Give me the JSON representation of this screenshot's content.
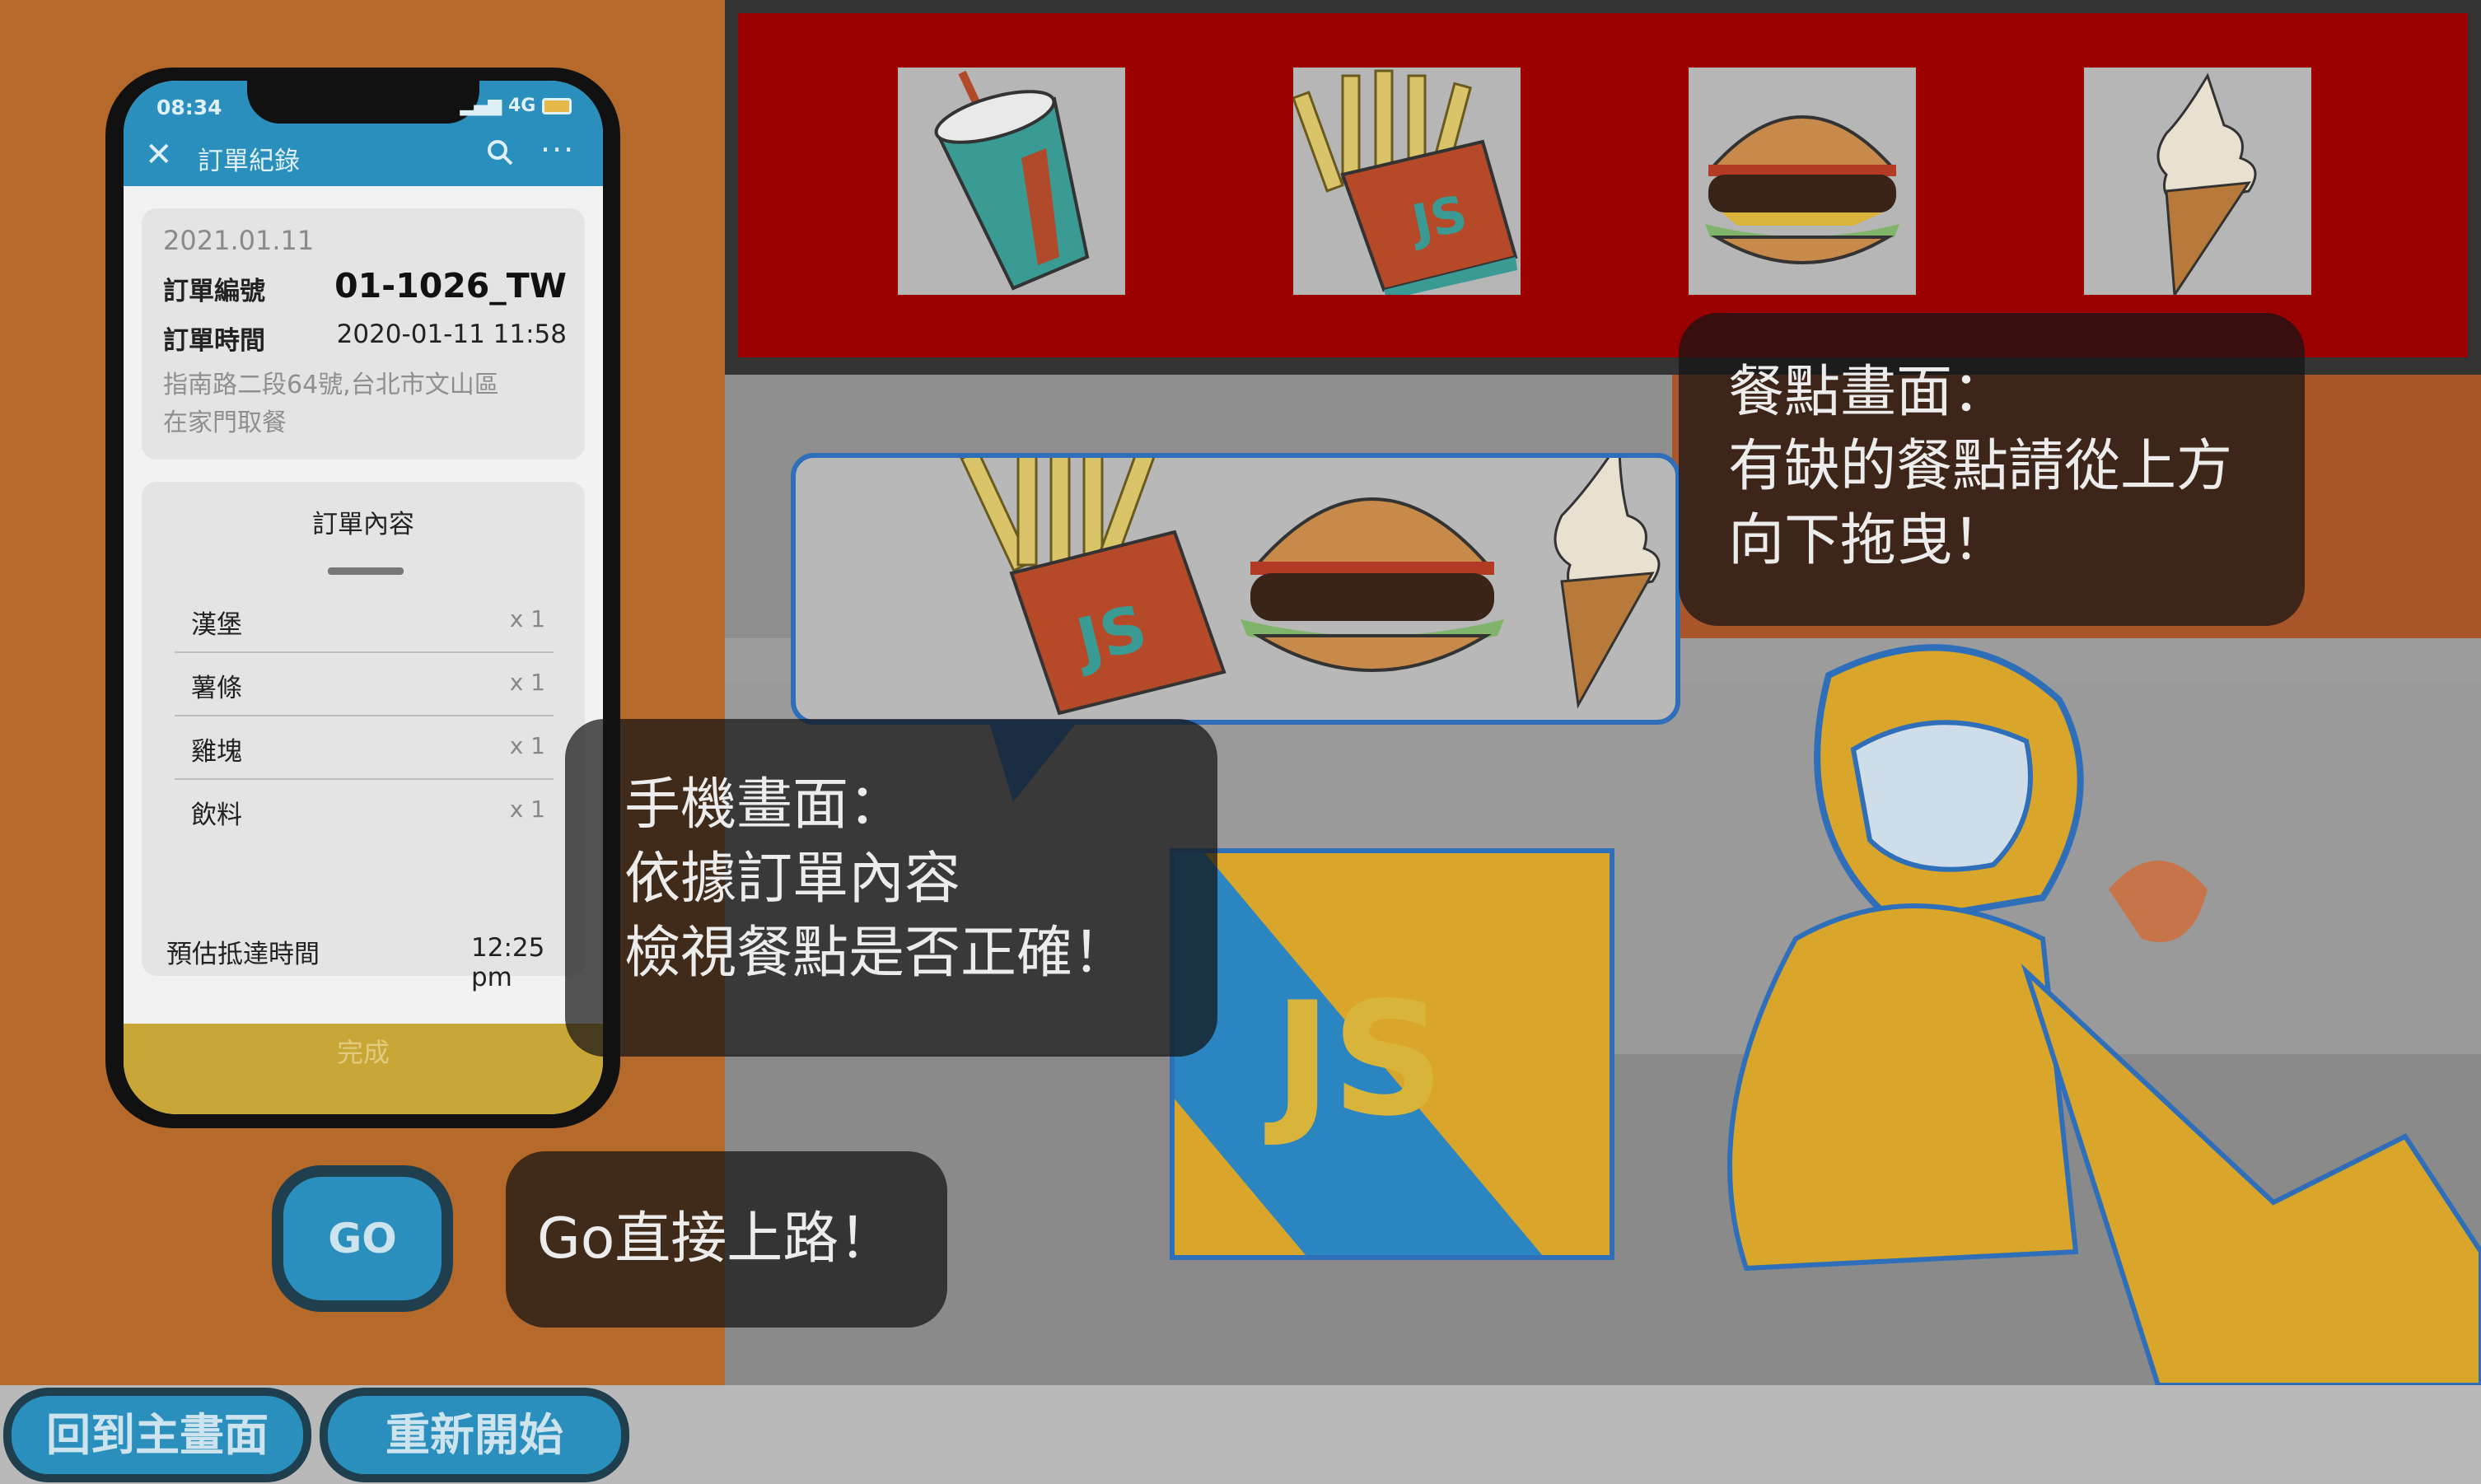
{
  "phone": {
    "status_time": "08:34",
    "status_network": "4G",
    "header_title": "訂單紀錄",
    "order": {
      "date": "2021.01.11",
      "number_label": "訂單編號",
      "number_value": "01-1026_TW",
      "time_label": "訂單時間",
      "time_value": "2020-01-11 11:58",
      "address_line1": "指南路二段64號,台北市文山區",
      "address_line2": "在家門取餐"
    },
    "content": {
      "title": "訂單內容",
      "items": [
        {
          "name": "漢堡",
          "qty": "x 1"
        },
        {
          "name": "薯條",
          "qty": "x 1"
        },
        {
          "name": "雞塊",
          "qty": "x 1"
        },
        {
          "name": "飲料",
          "qty": "x 1"
        }
      ],
      "eta_label": "預估抵達時間",
      "eta_value": "12:25 pm"
    },
    "done_label": "完成"
  },
  "go_button_label": "GO",
  "bubbles": {
    "go": "Go直接上路！",
    "phone": [
      "手機畫面：",
      "依據訂單內容",
      "檢視餐點是否正確！"
    ],
    "food": [
      "餐點畫面：",
      "有缺的餐點請從上方",
      "向下拖曳！"
    ]
  },
  "tray_items": [
    {
      "icon": "drink-cup-icon"
    },
    {
      "icon": "fries-icon",
      "text": "JS"
    },
    {
      "icon": "burger-icon"
    },
    {
      "icon": "ice-cream-icon"
    }
  ],
  "order_bubble_items": [
    "fries-icon",
    "burger-icon",
    "ice-cream-icon"
  ],
  "delivery_box_text": "JS",
  "fries_box_text": "JS",
  "bottom": {
    "home_label": "回到主畫面",
    "restart_label": "重新開始"
  },
  "colors": {
    "accent_blue": "#2a8fbd",
    "tray_red": "#9a0000",
    "panel_orange": "#b56a2c",
    "done_yellow": "#c9a737"
  }
}
